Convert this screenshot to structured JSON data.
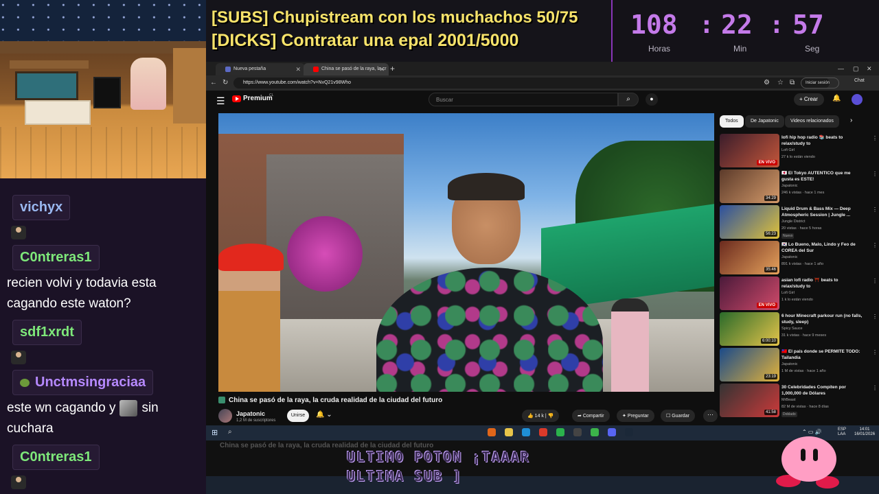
{
  "overlay": {
    "sub_goal_1": "[SUBS] Chupistream con los muchachos 50/75",
    "sub_goal_2": "[DICKS] Contratar una epal 2001/5000",
    "timer": {
      "hours": "108",
      "minutes": "22",
      "seconds": "57",
      "sep": ":",
      "hours_label": "Horas",
      "minutes_label": "Min",
      "seconds_label": "Seg"
    },
    "bottom_text_1": "ULTIMO POTON ¡TAAAR",
    "bottom_text_2": "ULTIMA SUB ]",
    "accent_color": "#c47ae9"
  },
  "chat": {
    "messages": [
      {
        "user": "vichyx",
        "color": "#9ab8f0",
        "text": ""
      },
      {
        "user": "C0ntreras1",
        "color": "#7ee87a",
        "text": "recien volvi y todavia esta cagando este waton?"
      },
      {
        "user": "sdf1xrdt",
        "color": "#7ee87a",
        "text": ""
      },
      {
        "user": "Unctmsingraciaa",
        "color": "#b689ff",
        "text_before": "este wn cagando y",
        "text_after": "sin cuchara"
      },
      {
        "user": "C0ntreras1",
        "color": "#7ee87a",
        "text": ""
      }
    ]
  },
  "browser": {
    "tabs": [
      {
        "label": "Nueva pestaña"
      },
      {
        "label": "China se pasó de la raya, la cr"
      }
    ],
    "url": "https://www.youtube.com/watch?v=NvQ21v98Who",
    "signin": "Iniciar sesión",
    "chat_label": "Chat"
  },
  "youtube": {
    "brand": "Premium",
    "country": "CL",
    "search_placeholder": "Buscar",
    "create_label": "Crear",
    "video_title": "China se pasó de la raya, la cruda realidad de la ciudad del futuro",
    "channel": "Japatonic",
    "subscribers": "1,2 M de suscriptores",
    "join_label": "Unirse",
    "likes": "14 k",
    "share_label": "Compartir",
    "ask_label": "Preguntar",
    "save_label": "Guardar",
    "chips": [
      "Todos",
      "De Japatonic",
      "Videos relacionados"
    ],
    "recommendations": [
      {
        "title": "lofi hip hop radio 📚 beats to relax/study to",
        "channel": "Lofi Girl",
        "meta": "27 k lo están viendo",
        "badge": "EN VIVO",
        "thumb": [
          "#3b1d2b",
          "#c4563a"
        ]
      },
      {
        "title": "🇯🇵 El Tokyo AUTENTICO que me gusta es ESTE!",
        "channel": "Japatonic",
        "meta": "246 k vistas · hace 1 mes",
        "duration": "34:29",
        "thumb": [
          "#5b3a2a",
          "#d49a6a"
        ]
      },
      {
        "title": "Liquid Drum & Bass Mix — Deep Atmospheric Session | Jungle ...",
        "channel": "Jungle District",
        "meta": "20 vistas · hace 5 horas",
        "tag": "Nuevo",
        "duration": "56:23",
        "thumb": [
          "#2a4fa0",
          "#e0c23a"
        ]
      },
      {
        "title": "🇰🇷 Lo Bueno, Malo, Lindo y Feo de COREA del Sur",
        "channel": "Japatonic",
        "meta": "891 k vistas · hace 1 año",
        "duration": "35:46",
        "thumb": [
          "#6a2a1e",
          "#e6a25c"
        ]
      },
      {
        "title": "asian lofi radio ⛩️ beats to relax/study to",
        "channel": "Lofi Girl",
        "meta": "1 k lo están viendo",
        "badge": "EN VIVO",
        "thumb": [
          "#4a1a3a",
          "#d04a6a"
        ]
      },
      {
        "title": "6 hour Minecraft parkour run (no falls, study, sleep)",
        "channel": "Spicy Sauce",
        "meta": "31 k vistas · hace 9 meses",
        "duration": "6:00:10",
        "thumb": [
          "#2a6a2a",
          "#e4c44a"
        ]
      },
      {
        "title": "🇹🇼 El país donde se PERMITE TODO: Tailandia",
        "channel": "Japatonic",
        "meta": "1 M de vistas · hace 1 año",
        "duration": "23:19",
        "thumb": [
          "#1a4a8a",
          "#e2b23a"
        ]
      },
      {
        "title": "30 Celebridades Compiten por 1,000,000 de Dólares",
        "channel": "MrBeast",
        "meta": "82 M de vistas · hace 8 días",
        "tag": "Doblado",
        "duration": "41:58",
        "thumb": [
          "#333333",
          "#cc3a3a"
        ]
      }
    ]
  },
  "taskbar": {
    "lang_1": "ESP",
    "lang_2": "LAA",
    "time": "14:01",
    "date": "16/01/2026"
  }
}
